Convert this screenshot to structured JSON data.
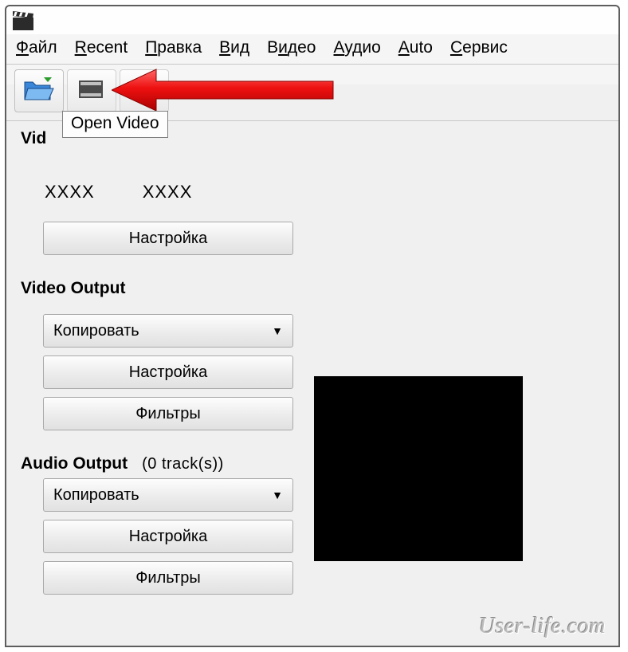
{
  "menu": {
    "file": {
      "pre": "",
      "u": "Ф",
      "post": "айл"
    },
    "recent": {
      "pre": "",
      "u": "R",
      "post": "ecent"
    },
    "edit": {
      "pre": "",
      "u": "П",
      "post": "равка"
    },
    "view": {
      "pre": "",
      "u": "В",
      "post": "ид"
    },
    "video": {
      "pre": "В",
      "u": "и",
      "post": "део"
    },
    "audio": {
      "pre": "",
      "u": "А",
      "post": "удио"
    },
    "auto": {
      "pre": "",
      "u": "A",
      "post": "uto"
    },
    "service": {
      "pre": "",
      "u": "С",
      "post": "ервис"
    }
  },
  "tooltip": "Open Video",
  "sections": {
    "video_decoder_heading_partial": "Vid",
    "resolution_a": "XXXX",
    "resolution_b": "XXXX",
    "configure": "Настройка",
    "video_output_heading": "Video Output",
    "video_output_select": "Копировать",
    "video_output_configure": "Настройка",
    "video_output_filters": "Фильтры",
    "audio_output_heading": "Audio Output",
    "audio_output_tracks": "(0 track(s))",
    "audio_output_select": "Копировать",
    "audio_output_configure": "Настройка",
    "audio_output_filters": "Фильтры"
  },
  "watermark": "User-life.com"
}
